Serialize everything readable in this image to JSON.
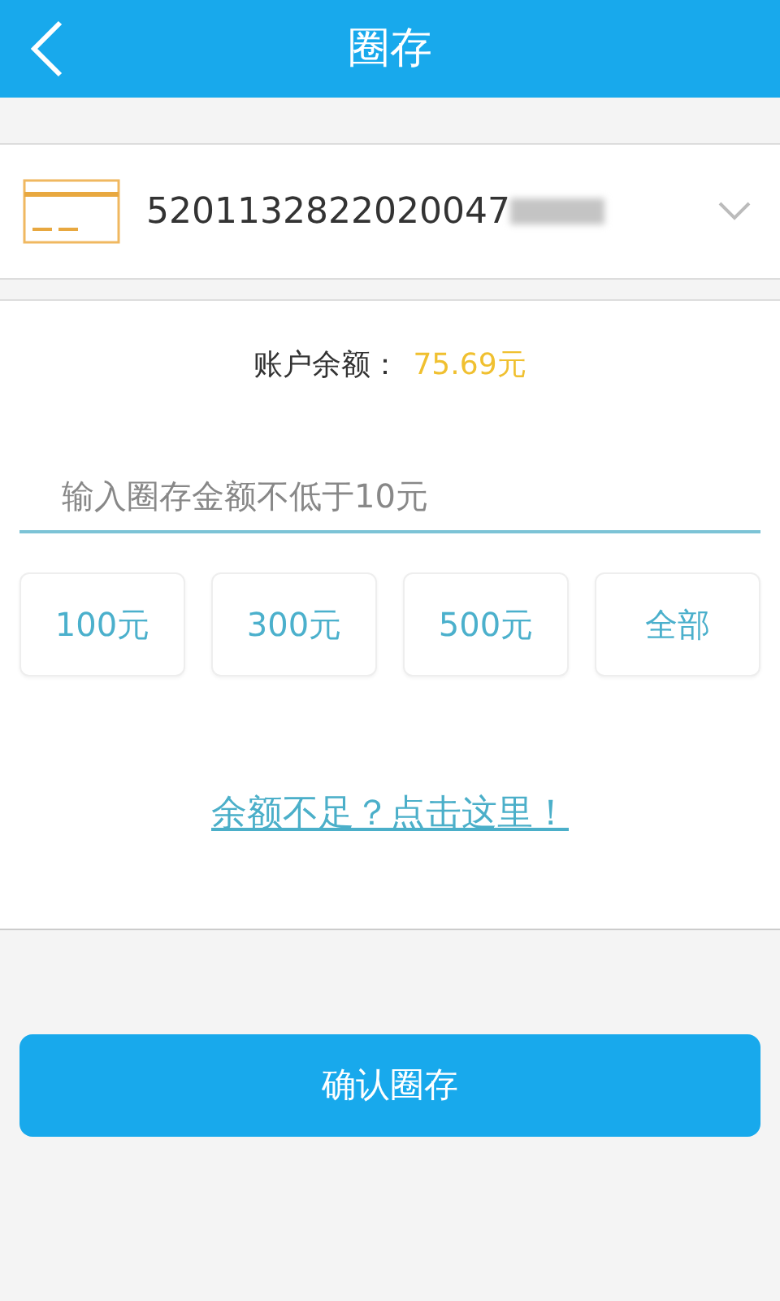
{
  "header": {
    "title": "圈存"
  },
  "card_selector": {
    "number": "5201132822020047",
    "redacted": true
  },
  "balance": {
    "label": "账户余额：",
    "value": "75.69元"
  },
  "amount_field": {
    "placeholder": "输入圈存金额不低于10元"
  },
  "quick_amounts": [
    "100元",
    "300元",
    "500元",
    "全部"
  ],
  "topup_link": "余额不足？点击这里！",
  "confirm_button": "确认圈存"
}
